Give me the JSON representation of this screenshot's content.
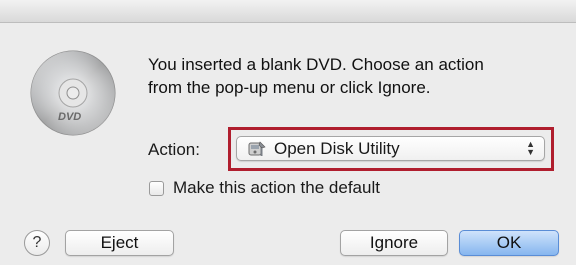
{
  "dialog": {
    "message": "You inserted a blank DVD. Choose an action\nfrom the pop-up menu or click Ignore.",
    "message_line1": "You inserted a blank DVD. Choose an action",
    "message_line2": "from the pop-up menu or click Ignore.",
    "icon": "dvd-disc-icon",
    "disc_label": "DVD"
  },
  "action": {
    "label": "Action:",
    "selected": "Open Disk Utility",
    "selected_icon": "disk-utility-icon",
    "highlight_color": "#b01e2e"
  },
  "checkbox": {
    "label": "Make this action the default",
    "checked": false
  },
  "buttons": {
    "help": "?",
    "eject": "Eject",
    "ignore": "Ignore",
    "ok": "OK"
  },
  "colors": {
    "background": "#ececec",
    "default_button": "#86b6ef"
  }
}
